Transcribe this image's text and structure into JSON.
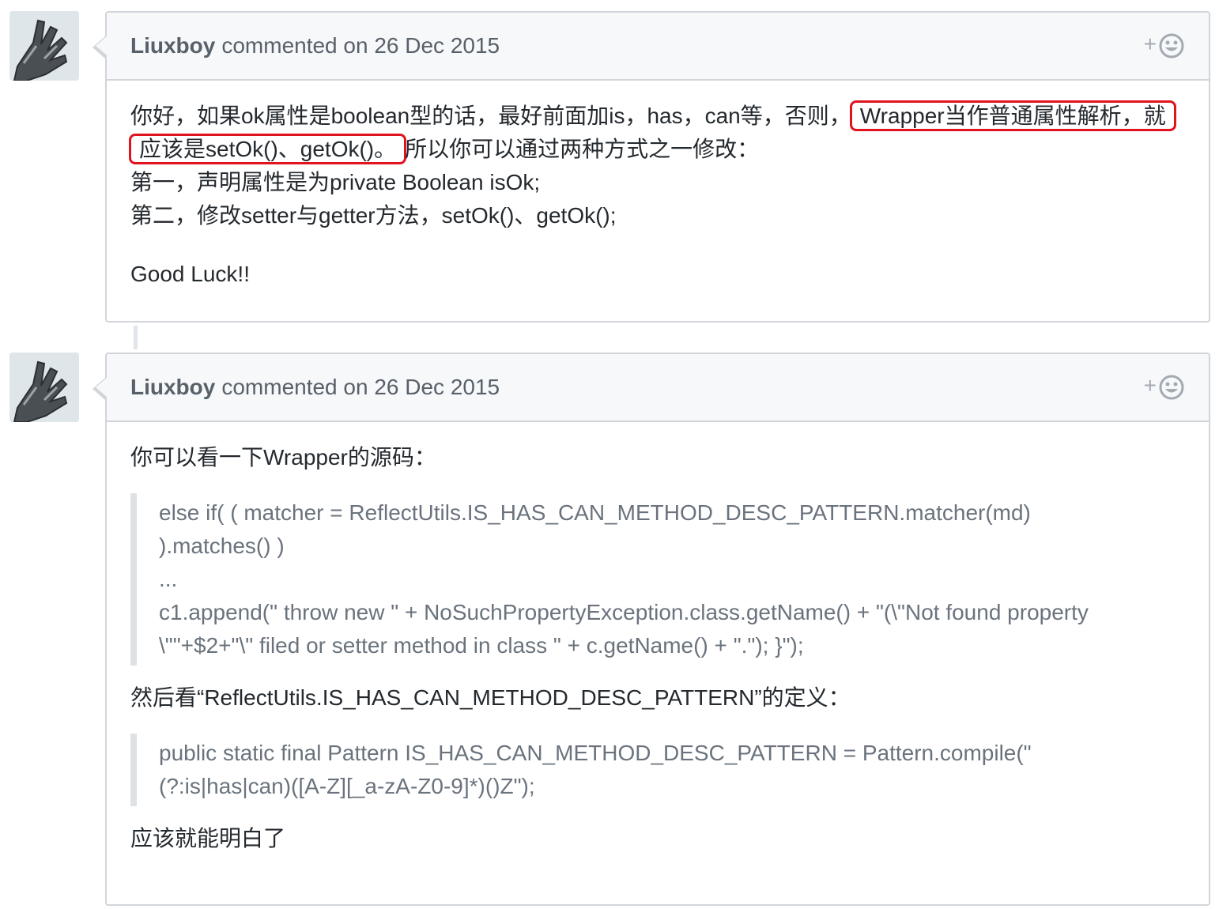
{
  "comments": [
    {
      "author": "Liuxboy",
      "meta": "commented on 26 Dec 2015",
      "reaction_label": "+",
      "body": {
        "p1_part1": "你好，如果ok属性是boolean型的话，最好前面加is，has，can等，否则，",
        "p1_hl1": "Wrapper当作普通属性解析，就",
        "p1_hl2": "应该是setOk()、getOk()。",
        "p1_part2": "所以你可以通过两种方式之一修改：",
        "line2": "第一，声明属性是为private Boolean isOk;",
        "line3": "第二，修改setter与getter方法，setOk()、getOk();",
        "closing": "Good Luck!!"
      }
    },
    {
      "author": "Liuxboy",
      "meta": "commented on 26 Dec 2015",
      "reaction_label": "+",
      "body": {
        "intro": "你可以看一下Wrapper的源码：",
        "quote1": [
          "else if( ( matcher = ReflectUtils.IS_HAS_CAN_METHOD_DESC_PATTERN.matcher(md)",
          ").matches() )",
          "...",
          "c1.append(\" throw new \" + NoSuchPropertyException.class.getName() + \"(\\\"Not found property",
          "\\\"\"+$2+\"\\\" filed or setter method in class \" + c.getName() + \".\"); }\");"
        ],
        "middle": "然后看“ReflectUtils.IS_HAS_CAN_METHOD_DESC_PATTERN”的定义：",
        "quote2": [
          "public static final Pattern IS_HAS_CAN_METHOD_DESC_PATTERN = Pattern.compile(\"",
          "(?:is|has|can)([A-Z][_a-zA-Z0-9]*)()Z\");"
        ],
        "closing": "应该就能明白了"
      }
    }
  ],
  "colors": {
    "highlight_box": "#e0141e",
    "header_bg": "#f6f8fa",
    "border": "#d1d5da",
    "quote_text": "#6a737d"
  },
  "icons": [
    "avatar-image",
    "add-reaction-plus",
    "smiley-icon"
  ]
}
